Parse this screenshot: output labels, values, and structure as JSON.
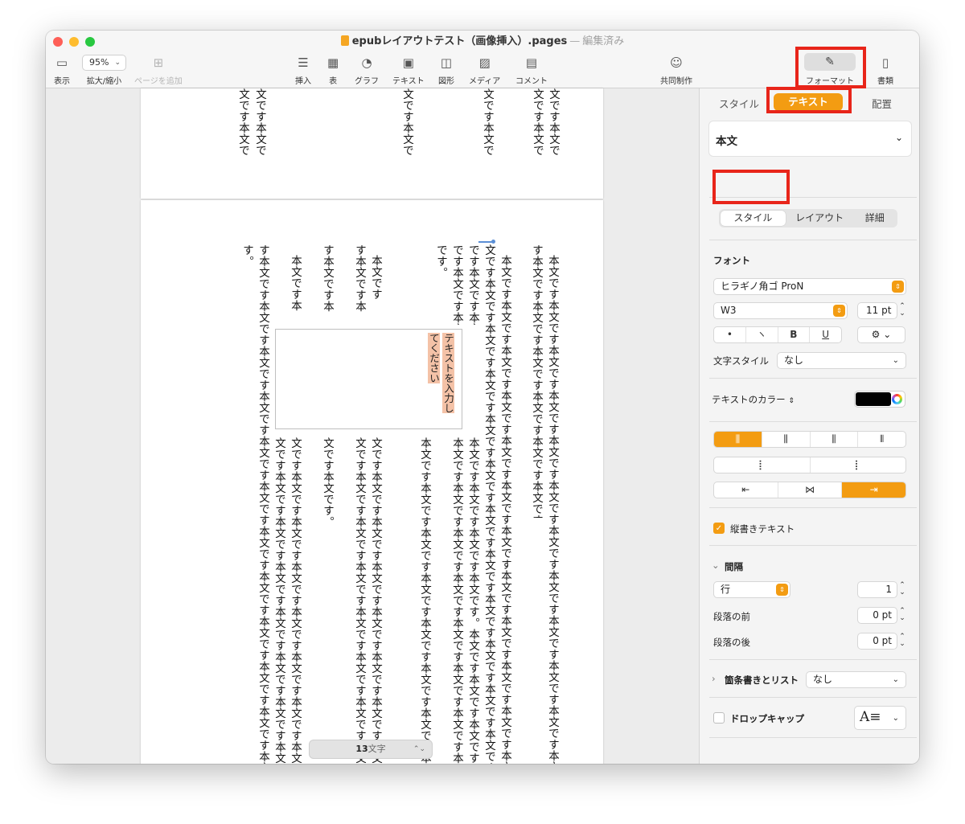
{
  "window": {
    "title": "epubレイアウトテスト（画像挿入）.pages",
    "title_separator": "—",
    "status": "編集済み"
  },
  "toolbar": {
    "view_label": "表示",
    "zoom_value": "95%",
    "zoom_label": "拡大/縮小",
    "add_page_label": "ページを追加",
    "insert_label": "挿入",
    "table_label": "表",
    "chart_label": "グラフ",
    "text_label": "テキスト",
    "shape_label": "図形",
    "media_label": "メディア",
    "comment_label": "コメント",
    "collab_label": "共同制作",
    "format_label": "フォーマット",
    "document_label": "書類"
  },
  "page1": {
    "columns": [
      "文です本文で",
      "文です本文で",
      "文です本文で",
      "文です本文で",
      "文です本文で",
      "文です本文で"
    ]
  },
  "page2": {
    "col1": "本文です本文です本文です本文です本文です本文です本文です本文です本文です本文です本文です本文です本文です本文です本文です本文です本文です本文です本文です本文です本文です本文です本文です本文です本文です本文",
    "col2": "す本文です本文です本文です本文です本文です本文です本文です本文です本文です本文です本文です本文です本文です本文です本文です本文です本文です本文です本文です。",
    "col3": "本文です本文です本文です本文です本文です本文です本文です本文です本文です本文です本文です本文です本文です本文です本文です本文です本文です本文です本文です本文です本文です本文です本文です本文です本文です本文です本文です本文です本文です本文です本文です本文です本文です本文です本文です本文です本文です本文です本文です本文です本文です本文です本文です本文です本文です本文です本文です本文です本文",
    "col4a": "す本文です本文です本文です本文",
    "col4b": "文です本文です本文です本文です本文です本文です本文です本文です本文です本文です本文です本文です本文です本文です本文です本文です本文です本文です本文です本文です本文です",
    "col5a": "です本文です本文です",
    "col5b": "本文です本文です本文です本文です。本文です本文です本文です本文です本文です本文です本文です本文です本文です本文です本文です本文です本文です本文です本文です本文です本文です本文です",
    "col6a": "です本文です本文です",
    "col6b": "本文です本文です本文です本文です本文です本文です本文です本文です本文です本文です本文です本文です本文です本文です本文です本文です本文です本文です本文です本文です本文です本文です",
    "col7a": "です。",
    "col8a": "本文です",
    "col8b": "文です本文です本文です本文です本文です本文です本文です本文です本文です本文です本文です本文です本文です本文です本文です本文です本文です本文です本文です本文です本文です本文です本文です本文",
    "col9a": "す本文です本",
    "col9b": "文です本文です本文です本文です本文です本文です本文です本文です本文です本文です本文です本文です本文です本文です本文です本文です本文です本文です本文です本文です本文です本文です本文です",
    "col10a": "す本文です本",
    "col10b": "文です本文です。",
    "col11a": "本文です本",
    "col11b": "文です本文です本文です本文です本文です本文です本文です本文です本文です本文です本文です本文です本文です本文です本文です本文です本文です本文です本文です本文です本文です本文です本文です本",
    "col12": "す本文です本文です本文です本文です本文です本文です本文です本文です本文です本文です本文です本文です本文です本文です本文です本文です本文です本文です本文です本文です本文です本文です本文です本文です本文です本文",
    "col13": "す。",
    "textbox_placeholder": "テキストを入力してください",
    "word_count_num": "13",
    "word_count_unit": "文字"
  },
  "inspector": {
    "tabs": [
      "スタイル",
      "テキスト",
      "配置"
    ],
    "paragraph_style": "本文",
    "sub_tabs": [
      "スタイル",
      "レイアウト",
      "詳細"
    ],
    "font_section": "フォント",
    "font_family": "ヒラギノ角ゴ ProN",
    "font_weight": "W3",
    "font_size": "11 pt",
    "char_buttons": [
      "•",
      "ヽ",
      "B",
      "U"
    ],
    "char_style_label": "文字スタイル",
    "char_style_value": "なし",
    "text_color_label": "テキストのカラー",
    "vertical_text_label": "縦書きテキスト",
    "spacing_label": "間隔",
    "line_type": "行",
    "line_value": "1",
    "before_label": "段落の前",
    "before_value": "0 pt",
    "after_label": "段落の後",
    "after_value": "0 pt",
    "bullets_label": "箇条書きとリスト",
    "bullets_value": "なし",
    "dropcap_label": "ドロップキャップ",
    "text_color": "#000000",
    "accent": "#f39c12"
  }
}
